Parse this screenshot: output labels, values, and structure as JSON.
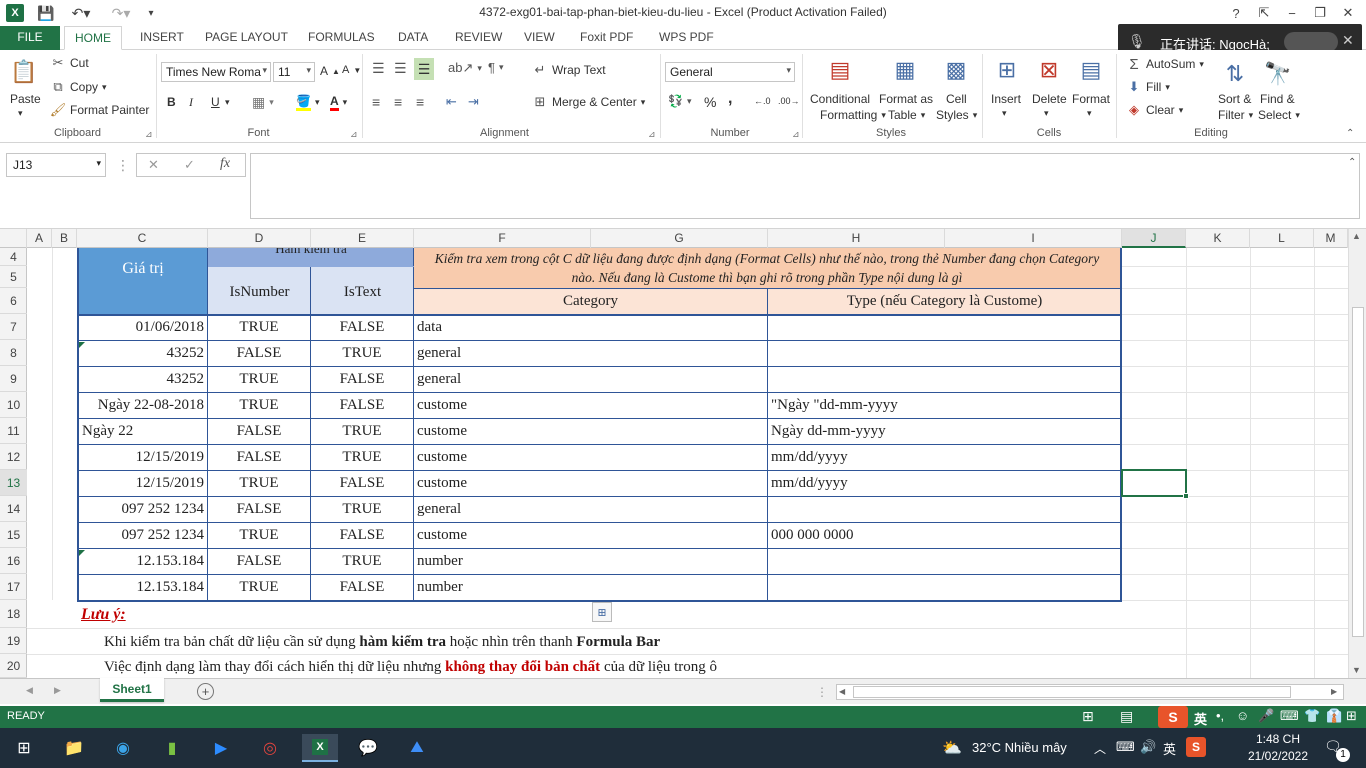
{
  "window": {
    "title": "4372-exg01-bai-tap-phan-biet-kieu-du-lieu - Excel (Product Activation Failed)",
    "help": "?",
    "controls": [
      "−",
      "❐",
      "✕"
    ]
  },
  "notification": {
    "text": "正在讲话: NgocHà;"
  },
  "tabs": [
    {
      "label": "FILE"
    },
    {
      "label": "HOME"
    },
    {
      "label": "INSERT"
    },
    {
      "label": "PAGE LAYOUT"
    },
    {
      "label": "FORMULAS"
    },
    {
      "label": "DATA"
    },
    {
      "label": "REVIEW"
    },
    {
      "label": "VIEW"
    },
    {
      "label": "Foxit PDF"
    },
    {
      "label": "WPS PDF"
    }
  ],
  "ribbon": {
    "clipboard": {
      "label": "Clipboard",
      "paste": "Paste",
      "cut": "Cut",
      "copy": "Copy",
      "format_painter": "Format Painter"
    },
    "font": {
      "label": "Font",
      "family": "Times New Roma",
      "size": "11",
      "bold": "B",
      "italic": "I",
      "underline": "U"
    },
    "alignment": {
      "label": "Alignment",
      "wrap": "Wrap Text",
      "merge": "Merge & Center"
    },
    "number": {
      "label": "Number",
      "format": "General",
      "percent": "%",
      "comma": ","
    },
    "styles": {
      "label": "Styles",
      "conditional": "Conditional",
      "conditional2": "Formatting",
      "format_table": "Format as",
      "format_table2": "Table",
      "cell_styles": "Cell",
      "cell_styles2": "Styles"
    },
    "cells": {
      "label": "Cells",
      "insert": "Insert",
      "delete": "Delete",
      "format": "Format"
    },
    "editing": {
      "label": "Editing",
      "autosum": "AutoSum",
      "fill": "Fill",
      "clear": "Clear",
      "sort": "Sort &",
      "sort2": "Filter",
      "find": "Find &",
      "find2": "Select"
    }
  },
  "formula_bar": {
    "name_box": "J13",
    "fx": "fx",
    "cancel": "✕",
    "enter": "✓",
    "value": ""
  },
  "columns": [
    "A",
    "B",
    "C",
    "D",
    "E",
    "F",
    "G",
    "H",
    "I",
    "J",
    "K",
    "L",
    "M"
  ],
  "rows": [
    "4",
    "5",
    "6",
    "7",
    "8",
    "9",
    "10",
    "11",
    "12",
    "13",
    "14",
    "15",
    "16",
    "17",
    "18",
    "19",
    "20"
  ],
  "table": {
    "header_value": "Giá trị",
    "header_group": "Hàm kiểm tra",
    "header_isnumber": "IsNumber",
    "header_istext": "IsText",
    "instruction": "Kiểm tra xem trong cột C dữ liệu đang được định dạng (Format Cells) như thế nào, trong thẻ Number đang chọn Category nào. Nếu đang là Custome thì bạn ghi rõ trong phần Type nội dung là gì",
    "header_category": "Category",
    "header_type": "Type (nếu Category là Custome)",
    "rows": [
      {
        "value": "01/06/2018",
        "align": "right",
        "isnumber": "TRUE",
        "istext": "FALSE",
        "category": "data",
        "type": ""
      },
      {
        "value": "43252",
        "align": "right",
        "isnumber": "FALSE",
        "istext": "TRUE",
        "category": "general",
        "type": ""
      },
      {
        "value": "43252",
        "align": "right",
        "isnumber": "TRUE",
        "istext": "FALSE",
        "category": "general",
        "type": ""
      },
      {
        "value": "Ngày 22-08-2018",
        "align": "right",
        "isnumber": "TRUE",
        "istext": "FALSE",
        "category": "custome",
        "type": "\"Ngày \"dd-mm-yyyy"
      },
      {
        "value": "Ngày 22",
        "align": "left",
        "isnumber": "FALSE",
        "istext": "TRUE",
        "category": "custome",
        "type": "Ngày dd-mm-yyyy"
      },
      {
        "value": "12/15/2019",
        "align": "right",
        "isnumber": "FALSE",
        "istext": "TRUE",
        "category": "custome",
        "type": "mm/dd/yyyy"
      },
      {
        "value": "12/15/2019",
        "align": "right",
        "isnumber": "TRUE",
        "istext": "FALSE",
        "category": "custome",
        "type": "mm/dd/yyyy"
      },
      {
        "value": "097 252 1234",
        "align": "right",
        "isnumber": "FALSE",
        "istext": "TRUE",
        "category": "general",
        "type": ""
      },
      {
        "value": "097 252 1234",
        "align": "right",
        "isnumber": "TRUE",
        "istext": "FALSE",
        "category": "custome",
        "type": "000 000 0000"
      },
      {
        "value": "12.153.184",
        "align": "right",
        "isnumber": "FALSE",
        "istext": "TRUE",
        "category": "number",
        "type": ""
      },
      {
        "value": "12.153.184",
        "align": "right",
        "isnumber": "TRUE",
        "istext": "FALSE",
        "category": "number",
        "type": ""
      }
    ]
  },
  "notes": {
    "title": "Lưu ý:",
    "line1_a": "Khi kiểm tra bản chất dữ liệu cần sử dụng ",
    "line1_b": "hàm kiểm tra",
    "line1_c": " hoặc nhìn trên thanh ",
    "line1_d": "Formula Bar",
    "line2_a": "Việc định dạng làm thay đổi cách hiển thị dữ liệu nhưng ",
    "line2_b": "không thay đổi bản chất",
    "line2_c": " của dữ liệu trong ô"
  },
  "sheet_tab": "Sheet1",
  "status": {
    "ready": "READY",
    "ime": "英"
  },
  "taskbar": {
    "weather": "32°C  Nhiều mây",
    "time": "1:48 CH",
    "date": "21/02/2022",
    "lang": "英",
    "notif_count": "1"
  },
  "colors": {
    "excel_green": "#217346",
    "header_blue": "#5b9bd5",
    "subheader_blue": "#dae3f3",
    "instruction_peach": "#f8cbad",
    "instruction_light": "#fce4d6",
    "border_blue": "#2f5597",
    "note_red": "#c00000"
  }
}
